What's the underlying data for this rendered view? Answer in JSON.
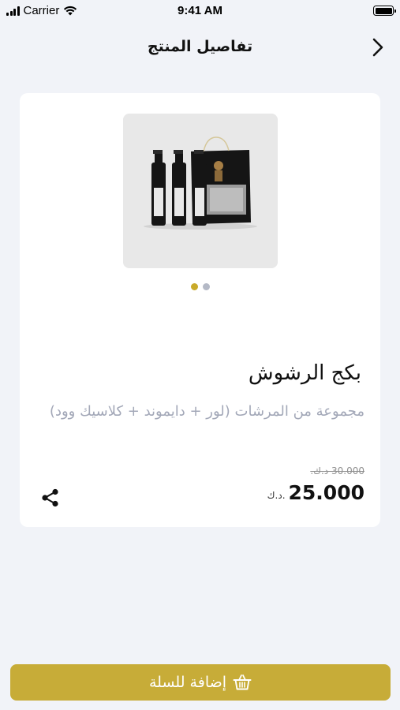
{
  "status_bar": {
    "carrier": "Carrier",
    "time": "9:41 AM"
  },
  "header": {
    "title": "تفاصيل المنتج",
    "back_icon": "chevron-right-icon"
  },
  "product": {
    "image_count": 2,
    "active_image_index": 0,
    "name": "بكج الرشوش",
    "description": "مجموعة من المرشات (لور + دايموند + كلاسيك وود)",
    "old_price": "30.000 د.ك.",
    "price": "25.000",
    "currency": "د.ك."
  },
  "actions": {
    "share_icon": "share-icon",
    "add_to_cart_label": "إضافة للسلة",
    "add_to_cart_icon": "basket-icon"
  },
  "colors": {
    "accent": "#c7ac38",
    "dot_active": "#c9aa2a",
    "dot_inactive": "#b4b9c6",
    "background": "#f1f3f8",
    "description_text": "#a3a8b8"
  }
}
